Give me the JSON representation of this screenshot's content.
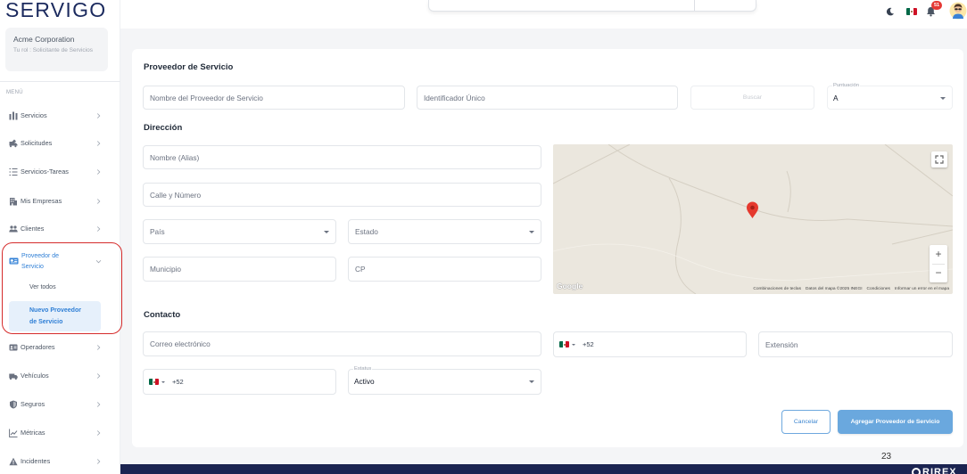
{
  "brand": {
    "logo": "SERVIGO"
  },
  "theme": {
    "primary": "#2f7fd6",
    "button": "#6aa8de",
    "selected_bg": "#e6f0fb",
    "annotation": "#d52b2b",
    "map_bg": "#ebe7de",
    "pin": "#e5392e",
    "footer_bar": "#1b2451",
    "badge": "#e53935"
  },
  "org": {
    "name": "Acme Corporation",
    "role": "Tu rol : Solicitante de Servicios"
  },
  "sidebar": {
    "menu_label": "MENÚ",
    "items": [
      {
        "label": "Servicios",
        "icon": "bar-chart-icon"
      },
      {
        "label": "Solicitudes",
        "icon": "truck-edit-icon"
      },
      {
        "label": "Servicios-Tareas",
        "icon": "task-list-icon"
      },
      {
        "label": "Mis Empresas",
        "icon": "building-icon"
      },
      {
        "label": "Clientes",
        "icon": "users-icon"
      },
      {
        "label": "Proveedor de Servicio",
        "icon": "id-card-icon",
        "expanded": true,
        "children": [
          {
            "label": "Ver todos"
          },
          {
            "label": "Nuevo Proveedor de Servicio",
            "selected": true
          }
        ]
      },
      {
        "label": "Operadores",
        "icon": "id-badge-icon"
      },
      {
        "label": "Vehículos",
        "icon": "truck-icon"
      },
      {
        "label": "Seguros",
        "icon": "shield-icon"
      },
      {
        "label": "Métricas",
        "icon": "line-chart-icon"
      },
      {
        "label": "Incidentes",
        "icon": "warning-icon"
      }
    ]
  },
  "topbar": {
    "theme_toggle_icon": "moon-icon",
    "language_flag": "mexico-flag-icon",
    "notifications_count": "51",
    "avatar_icon": "user-avatar-icon"
  },
  "form": {
    "provider_section": {
      "title": "Proveedor de Servicio",
      "name_placeholder": "Nombre del Proveedor de Servicio",
      "identifier_placeholder": "Identificador Único",
      "search_button": "Buscar",
      "rating_label": "Puntuación",
      "rating_value": "A"
    },
    "address_section": {
      "title": "Dirección",
      "alias_placeholder": "Nombre (Alias)",
      "street_placeholder": "Calle y Número",
      "country_placeholder": "País",
      "state_placeholder": "Estado",
      "municipality_placeholder": "Municipio",
      "zip_placeholder": "CP"
    },
    "map": {
      "logo": "Google",
      "zoom_in": "+",
      "zoom_out": "−",
      "attribution": [
        "Combinaciones de teclas",
        "Datos del mapa ©2025 INEGI",
        "Condiciones",
        "Informar un error en el mapa"
      ]
    },
    "contact_section": {
      "title": "Contacto",
      "email_placeholder": "Correo electrónico",
      "phone_code": "+52",
      "extension_placeholder": "Extensión",
      "phone2_code": "+52",
      "status_label": "Estatus",
      "status_value": "Activo"
    },
    "actions": {
      "cancel": "Cancelar",
      "submit": "Agregar Proveedor de Servicio"
    }
  },
  "pagination": {
    "page": "23"
  },
  "footer": {
    "brand": "RIREX"
  }
}
